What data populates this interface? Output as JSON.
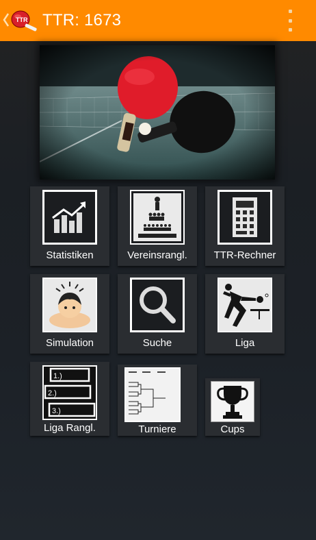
{
  "header": {
    "title": "TTR: 1673",
    "logo_text": "TTR",
    "accent_color": "#ff8a00"
  },
  "grid": {
    "statistiken": "Statistiken",
    "vereinsrangl": "Vereinsrangl.",
    "ttr_rechner": "TTR-Rechner",
    "simulation": "Simulation",
    "suche": "Suche",
    "liga": "Liga",
    "liga_rangl": "Liga Rangl.",
    "turniere": "Turniere",
    "cups": "Cups"
  },
  "liga_rangl_icon": {
    "rank1": "1.)",
    "rank2": "2.)",
    "rank3": "3.)"
  },
  "icons": {
    "statistiken": "bar-chart-icon",
    "vereinsrangl": "club-ranking-icon",
    "ttr_rechner": "calculator-icon",
    "simulation": "person-icon",
    "suche": "magnifier-icon",
    "liga": "table-tennis-player-icon",
    "liga_rangl": "ranking-list-icon",
    "turniere": "tournament-bracket-icon",
    "cups": "trophy-icon"
  }
}
